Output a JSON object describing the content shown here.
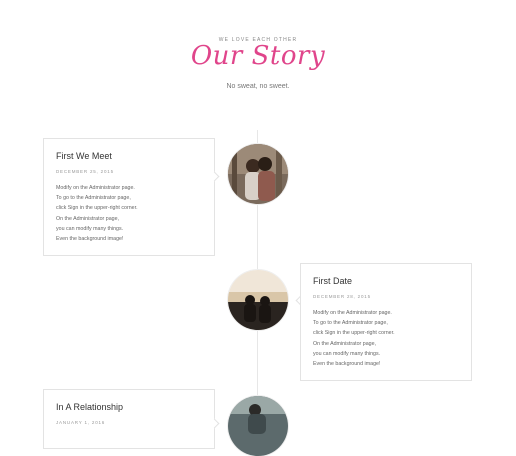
{
  "header": {
    "eyebrow": "WE LOVE EACH OTHER",
    "title": "Our Story",
    "subtitle": "No sweat, no sweet."
  },
  "events": [
    {
      "title": "First We Meet",
      "date": "DECEMBER 25, 2015",
      "body": [
        "Modify on the Administrator page.",
        "To go to the Administrator page,",
        "click Sign in the upper-right corner.",
        "On the Administrator page,",
        "you can modify many things.",
        "Even the background image!"
      ]
    },
    {
      "title": "First Date",
      "date": "DECEMBER 28, 2015",
      "body": [
        "Modify on the Administrator page.",
        "To go to the Administrator page,",
        "click Sign in the upper-right corner.",
        "On the Administrator page,",
        "you can modify many things.",
        "Even the background image!"
      ]
    },
    {
      "title": "In A Relationship",
      "date": "JANUARY 1, 2016"
    }
  ],
  "colors": {
    "accent": "#e0458b"
  }
}
